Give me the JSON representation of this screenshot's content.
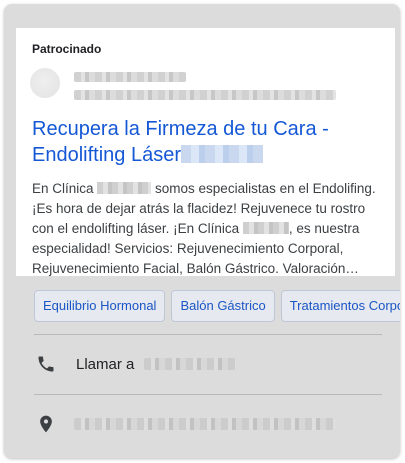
{
  "ad": {
    "sponsored_label": "Patrocinado",
    "headline": "Recupera la Firmeza de tu Cara - Endolifting Láser",
    "description": {
      "part1": "En Clínica ",
      "part2": " somos especialistas en el Endolifing. ¡Es hora de dejar atrás la flacidez! Rejuvenece tu rostro con el endolifting láser. ¡En Clínica ",
      "part3": ", es nuestra especialidad! Servicios: Rejuvenecimiento Corporal, Rejuvenecimiento Facial, Balón Gástrico. Valoración…"
    }
  },
  "chips": [
    {
      "label": "Equilibrio Hormonal"
    },
    {
      "label": "Balón Gástrico"
    },
    {
      "label": "Tratamientos Corporales"
    }
  ],
  "actions": {
    "call_label": "Llamar a",
    "call_icon": "phone-icon",
    "location_icon": "location-pin-icon"
  },
  "colors": {
    "link": "#1558d6",
    "card_background": "#dcdcdc",
    "text": "#202124"
  }
}
